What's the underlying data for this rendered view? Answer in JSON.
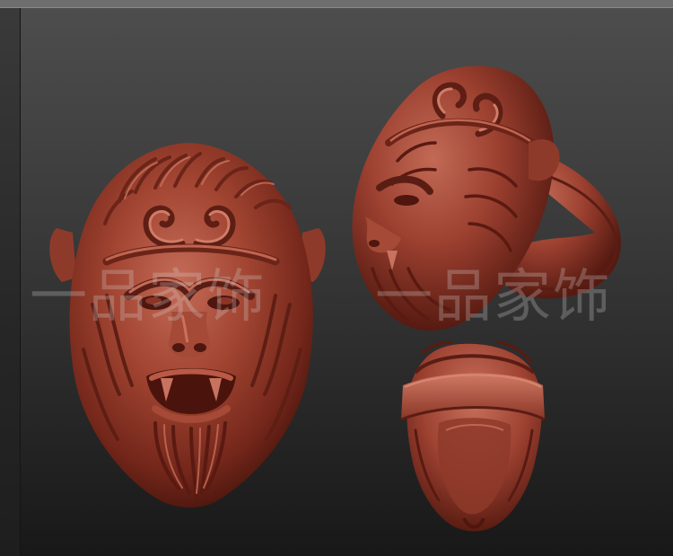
{
  "watermark": {
    "left_text": "一品家饰",
    "right_text": "一品家饰"
  },
  "colors": {
    "clay_base": "#9a3a2a",
    "clay_light": "#c06552",
    "clay_dark": "#5a1d14",
    "background_top": "#4d4d4d",
    "background_bottom": "#181818"
  }
}
